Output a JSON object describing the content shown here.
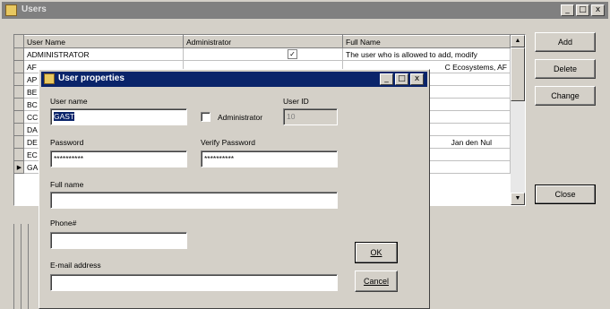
{
  "window": {
    "title": "Users"
  },
  "titlebar_buttons": {
    "minimize": "_",
    "maximize": "□",
    "close": "x"
  },
  "grid": {
    "columns": [
      "User Name",
      "Administrator",
      "Full Name"
    ],
    "rows": [
      {
        "indicator": "",
        "user": "ADMINISTRATOR",
        "admin": "✓",
        "full": "The user who is allowed to add, modify"
      },
      {
        "indicator": "",
        "user": "AF",
        "admin": "",
        "full": "C Ecosystems, AF"
      },
      {
        "indicator": "",
        "user": "AP",
        "admin": "",
        "full": ""
      },
      {
        "indicator": "",
        "user": "BE",
        "admin": "",
        "full": ""
      },
      {
        "indicator": "",
        "user": "BC",
        "admin": "",
        "full": ""
      },
      {
        "indicator": "",
        "user": "CC",
        "admin": "",
        "full": ""
      },
      {
        "indicator": "",
        "user": "DA",
        "admin": "",
        "full": ""
      },
      {
        "indicator": "",
        "user": "DE",
        "admin": "",
        "full": "Jan den Nul"
      },
      {
        "indicator": "",
        "user": "EC",
        "admin": "",
        "full": ""
      },
      {
        "indicator": "▶",
        "user": "GA",
        "admin": "",
        "full": ""
      }
    ]
  },
  "buttons": {
    "add": "Add",
    "delete": "Delete",
    "change": "Change",
    "close": "Close"
  },
  "dialog": {
    "title": "User properties",
    "labels": {
      "username": "User name",
      "userid": "User ID",
      "administrator": "Administrator",
      "password": "Password",
      "verify": "Verify Password",
      "fullname": "Full name",
      "phone": "Phone#",
      "email": "E-mail address"
    },
    "values": {
      "username": "GAST",
      "userid": "10",
      "password": "**********",
      "verify": "**********",
      "fullname": "",
      "phone": "",
      "email": ""
    },
    "ok": "OK",
    "cancel": "Cancel"
  }
}
